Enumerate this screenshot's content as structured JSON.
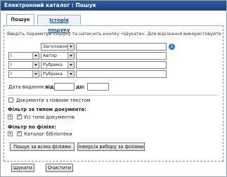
{
  "window": {
    "title": "Електронний каталог : Пошук"
  },
  "tabs": [
    {
      "label": "Пошук"
    },
    {
      "label": "Історія пошуку"
    }
  ],
  "instructions": "Введіть параметри пошуку та натисніть кнопку «Шукати». Для відсікання використовуйте \"",
  "search_rows": [
    {
      "operator": "",
      "field": "Заголовок",
      "value": ""
    },
    {
      "operator": "I",
      "field": "Автор",
      "value": ""
    },
    {
      "operator": "I",
      "field": "Рубрика",
      "value": ""
    },
    {
      "operator": "I",
      "field": "Рубрика",
      "value": ""
    }
  ],
  "info_icon": "i",
  "date": {
    "label": "Дата видання:",
    "from_label": "від:",
    "to_label": "до:",
    "from": "",
    "to": ""
  },
  "fulltext": {
    "label": "Документи з повним текстом",
    "checked": false
  },
  "doc_type_filter": {
    "title": "Фільтр за типом документа:",
    "toggle": "+",
    "item_label": "Усі типи документів",
    "checked": true
  },
  "branch_filter": {
    "title": "Фільтр по філіях:",
    "toggle": "+",
    "item_label": "Каталог бібліотеки",
    "checked": true
  },
  "buttons": {
    "search_all": "Пошук за всіма філіями",
    "invert": "Інверсія вибору за філіями",
    "search": "Шукати",
    "clear": "Очистити"
  },
  "colors": {
    "titlebar": "#1d3f78",
    "accent": "#2a78d0",
    "border": "#9bb0c6"
  }
}
